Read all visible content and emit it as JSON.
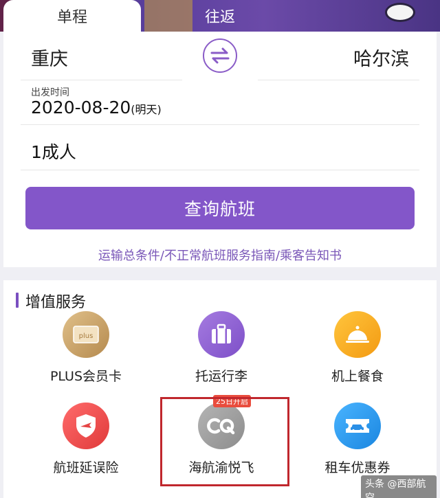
{
  "tabs": {
    "oneway": "单程",
    "round": "往返"
  },
  "route": {
    "from": "重庆",
    "to": "哈尔滨"
  },
  "date": {
    "label": "出发时间",
    "value": "2020-08-20",
    "tag": "(明天)"
  },
  "passengers": "1成人",
  "search_button": "查询航班",
  "terms_link": "运输总条件/不正常航班服务指南/乘客告知书",
  "services": {
    "title": "增值服务",
    "items": [
      {
        "label": "PLUS会员卡",
        "icon": "plus-card-icon"
      },
      {
        "label": "托运行李",
        "icon": "luggage-icon"
      },
      {
        "label": "机上餐食",
        "icon": "meal-cloche-icon"
      },
      {
        "label": "航班延误险",
        "icon": "shield-plane-icon"
      },
      {
        "label": "海航渝悦飞",
        "icon": "cq-logo-icon",
        "badge": "25日开启"
      },
      {
        "label": "租车优惠券",
        "icon": "car-coupon-icon"
      }
    ]
  },
  "watermark": "头条 @西部航空",
  "colors": {
    "accent": "#8356c9",
    "badge": "#e94c3d",
    "highlight": "#c0272d"
  }
}
